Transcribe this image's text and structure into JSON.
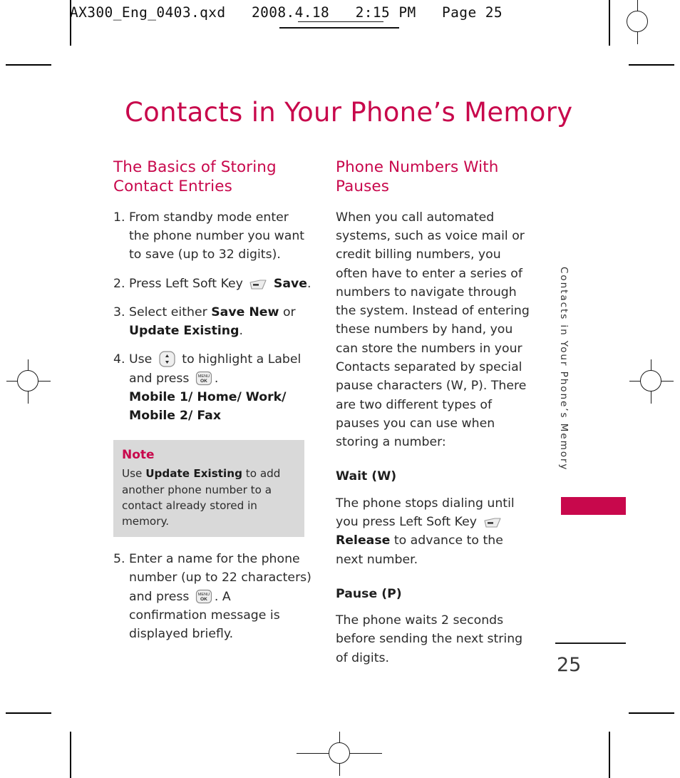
{
  "printer_slug": {
    "filename": "AX300_Eng_0403.qxd",
    "date": "2008.4.18",
    "time": "2:15 PM",
    "page_label": "Page 25",
    "full_line": "AX300_Eng_0403.qxd   2008.4.18   2:15 PM   Page 25"
  },
  "colors": {
    "accent": "#c8084c",
    "body_text": "#2b2b2b",
    "note_background": "#d9d9d9"
  },
  "page": {
    "title": "Contacts in Your Phone’s Memory",
    "running_head": "Contacts in Your Phone’s Memory",
    "folio": "25"
  },
  "left_column": {
    "heading": "The Basics of Storing Contact Entries",
    "steps": [
      {
        "number": "1.",
        "text": "From standby mode enter the phone number you want to save (up to 32 digits)."
      },
      {
        "number": "2.",
        "text_before": "Press Left Soft Key",
        "icon": "left-soft-key-icon",
        "bold_after": "Save",
        "text_after": "."
      },
      {
        "number": "3.",
        "text_before": "Select either",
        "bold_1": "Save New",
        "text_mid": "or",
        "bold_2": "Update Existing",
        "text_after": "."
      },
      {
        "number": "4.",
        "text_before": "Use",
        "icon_1": "navigation-updown-key-icon",
        "text_mid": "to highlight a Label and press",
        "icon_2": "menu-ok-key-icon",
        "text_after": ".",
        "labels_line_1": "Mobile 1/ Home/ Work/",
        "labels_line_2": "Mobile 2/ Fax"
      },
      {
        "number": "5.",
        "text_before": "Enter a name for the phone number (up to 22 characters) and press",
        "icon": "menu-ok-key-icon",
        "text_after": ". A confirmation message is displayed briefly."
      }
    ],
    "note": {
      "title": "Note",
      "text_before": "Use",
      "bold": "Update Existing",
      "text_after": "to add another phone number to a contact already stored in memory."
    }
  },
  "right_column": {
    "heading": "Phone Numbers With Pauses",
    "intro": "When you call automated systems, such as voice mail or credit billing numbers, you often have to enter a series of numbers to navigate through the system. Instead of entering these numbers by hand, you can store the numbers in your Contacts separated by special pause characters (W, P). There are two different types of pauses you can use when storing a number:",
    "subsections": [
      {
        "heading": "Wait (W)",
        "text_before": "The phone stops dialing until you press Left Soft Key",
        "icon": "left-soft-key-icon",
        "bold": "Release",
        "text_after": "to advance to the next number."
      },
      {
        "heading": "Pause (P)",
        "text": "The phone waits 2 seconds before sending the next string of digits."
      }
    ]
  }
}
